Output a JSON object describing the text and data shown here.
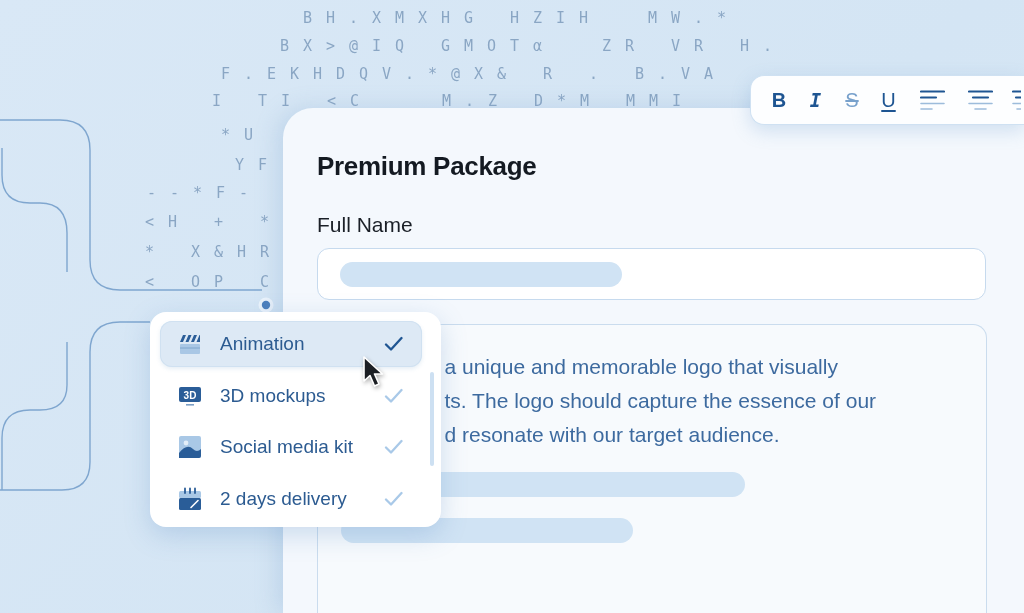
{
  "background_glyphs": [
    "B H . X M X H G   H Z I H     M W . *",
    "B X > @ I Q   G M O T α     Z R   V R   H .",
    "F . E K H D Q V . * @ X &   R   .   B . V A",
    "I   T I   < C       M . Z   D * M   M M I",
    "* U",
    "Y F",
    "- - * F -",
    "< H   +   *",
    "*   X & H R",
    "<   O P   C"
  ],
  "toolbar": {
    "buttons": [
      {
        "label": "B",
        "kind": "bold",
        "disabled": false
      },
      {
        "label": "I",
        "kind": "italic",
        "disabled": false
      },
      {
        "label": "S",
        "kind": "strikethrough",
        "disabled": true
      },
      {
        "label": "U",
        "kind": "underline",
        "disabled": false
      }
    ]
  },
  "form": {
    "title": "Premium Package",
    "full_name": {
      "label": "Full Name"
    },
    "description": {
      "lines": [
        "a unique and memorable logo that visually",
        "ts. The logo should capture the essence of our",
        "d resonate with our target audience."
      ]
    }
  },
  "dropdown": {
    "items": [
      {
        "label": "Animation",
        "selected": true
      },
      {
        "label": "3D mockups",
        "selected": false,
        "icon_text": "3D"
      },
      {
        "label": "Social media kit",
        "selected": false
      },
      {
        "label": "2 days delivery",
        "selected": false
      }
    ]
  }
}
